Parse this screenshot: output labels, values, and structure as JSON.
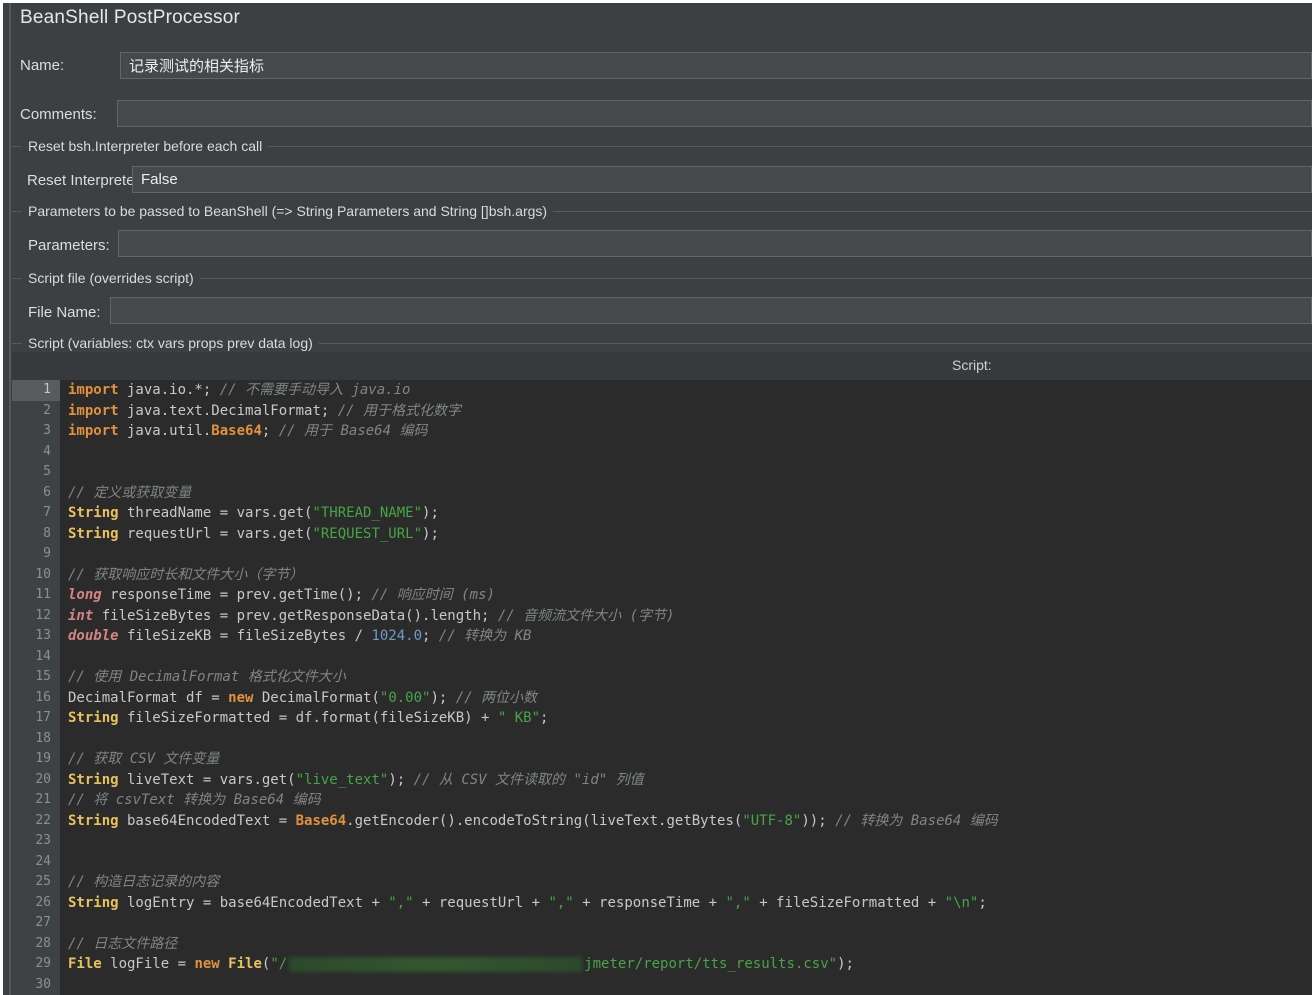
{
  "header": {
    "title": "BeanShell PostProcessor"
  },
  "fields": {
    "name": {
      "label": "Name:",
      "value": "记录测试的相关指标"
    },
    "comments": {
      "label": "Comments:",
      "value": ""
    }
  },
  "groups": {
    "reset": {
      "title": "Reset bsh.Interpreter before each call",
      "field_label": "Reset Interpreter:",
      "value": "False"
    },
    "parameters": {
      "title": "Parameters to be passed to BeanShell (=> String Parameters and String []bsh.args)",
      "field_label": "Parameters:",
      "value": ""
    },
    "script_file": {
      "title": "Script file (overrides script)",
      "field_label": "File Name:",
      "value": ""
    },
    "script": {
      "title": "Script (variables: ctx vars props prev data log)",
      "header_label": "Script:"
    }
  },
  "colors": {
    "panel_bg": "#3C4043",
    "editor_bg": "#2B2B2B",
    "gutter_bg": "#3E4244",
    "keyword": "#E2923C",
    "class_type": "#E8C25B",
    "primitive_type": "#D58484",
    "string": "#46A546",
    "number": "#6E9BC8",
    "comment": "#7F8587"
  },
  "editor": {
    "active_line": 1,
    "lines": [
      [
        [
          "kw",
          "import"
        ],
        [
          "pln",
          " java.io.*; "
        ],
        [
          "com",
          "// 不需要手动导入 java.io"
        ]
      ],
      [
        [
          "kw",
          "import"
        ],
        [
          "pln",
          " java.text.DecimalFormat; "
        ],
        [
          "com",
          "// 用于格式化数字"
        ]
      ],
      [
        [
          "kw",
          "import"
        ],
        [
          "pln",
          " java.util."
        ],
        [
          "kw",
          "Base64"
        ],
        [
          "pln",
          "; "
        ],
        [
          "com",
          "// 用于 Base64 编码"
        ]
      ],
      [],
      [],
      [
        [
          "com",
          "// 定义或获取变量"
        ]
      ],
      [
        [
          "cls",
          "String"
        ],
        [
          "pln",
          " threadName = vars.get("
        ],
        [
          "str",
          "\"THREAD_NAME\""
        ],
        [
          "pln",
          ");"
        ]
      ],
      [
        [
          "cls",
          "String"
        ],
        [
          "pln",
          " requestUrl = vars.get("
        ],
        [
          "str",
          "\"REQUEST_URL\""
        ],
        [
          "pln",
          ");"
        ]
      ],
      [],
      [
        [
          "com",
          "// 获取响应时长和文件大小（字节）"
        ]
      ],
      [
        [
          "prim",
          "long"
        ],
        [
          "pln",
          " responseTime = prev.getTime(); "
        ],
        [
          "com",
          "// 响应时间 (ms)"
        ]
      ],
      [
        [
          "prim",
          "int"
        ],
        [
          "pln",
          " fileSizeBytes = prev.getResponseData().length; "
        ],
        [
          "com",
          "// 音频流文件大小 (字节)"
        ]
      ],
      [
        [
          "prim",
          "double"
        ],
        [
          "pln",
          " fileSizeKB = fileSizeBytes / "
        ],
        [
          "num",
          "1024.0"
        ],
        [
          "pln",
          "; "
        ],
        [
          "com",
          "// 转换为 KB"
        ]
      ],
      [],
      [
        [
          "com",
          "// 使用 DecimalFormat 格式化文件大小"
        ]
      ],
      [
        [
          "pln",
          "DecimalFormat df = "
        ],
        [
          "kw",
          "new"
        ],
        [
          "pln",
          " DecimalFormat("
        ],
        [
          "str",
          "\"0.00\""
        ],
        [
          "pln",
          "); "
        ],
        [
          "com",
          "// 两位小数"
        ]
      ],
      [
        [
          "cls",
          "String"
        ],
        [
          "pln",
          " fileSizeFormatted = df.format(fileSizeKB) + "
        ],
        [
          "str",
          "\" KB\""
        ],
        [
          "pln",
          ";"
        ]
      ],
      [],
      [
        [
          "com",
          "// 获取 CSV 文件变量"
        ]
      ],
      [
        [
          "cls",
          "String"
        ],
        [
          "pln",
          " liveText = vars.get("
        ],
        [
          "str",
          "\"live_text\""
        ],
        [
          "pln",
          "); "
        ],
        [
          "com",
          "// 从 CSV 文件读取的 \"id\" 列值"
        ]
      ],
      [
        [
          "com",
          "// 将 csvText 转换为 Base64 编码"
        ]
      ],
      [
        [
          "cls",
          "String"
        ],
        [
          "pln",
          " base64EncodedText = "
        ],
        [
          "kw",
          "Base64"
        ],
        [
          "pln",
          ".getEncoder().encodeToString(liveText.getBytes("
        ],
        [
          "str",
          "\"UTF-8\""
        ],
        [
          "pln",
          ")); "
        ],
        [
          "com",
          "// 转换为 Base64 编码"
        ]
      ],
      [],
      [],
      [
        [
          "com",
          "// 构造日志记录的内容"
        ]
      ],
      [
        [
          "cls",
          "String"
        ],
        [
          "pln",
          " logEntry = base64EncodedText + "
        ],
        [
          "str",
          "\",\""
        ],
        [
          "pln",
          " + requestUrl + "
        ],
        [
          "str",
          "\",\""
        ],
        [
          "pln",
          " + responseTime + "
        ],
        [
          "str",
          "\",\""
        ],
        [
          "pln",
          " + fileSizeFormatted + "
        ],
        [
          "str",
          "\"\\n\""
        ],
        [
          "pln",
          ";"
        ]
      ],
      [],
      [
        [
          "com",
          "// 日志文件路径"
        ]
      ],
      [
        [
          "cls",
          "File"
        ],
        [
          "pln",
          " logFile = "
        ],
        [
          "kw",
          "new"
        ],
        [
          "pln",
          " "
        ],
        [
          "cls",
          "File"
        ],
        [
          "pln",
          "("
        ],
        [
          "str",
          "\"/"
        ],
        [
          "redact",
          ""
        ],
        [
          "str",
          "jmeter/report/tts_results.csv\""
        ],
        [
          "pln",
          ");"
        ]
      ],
      []
    ]
  }
}
